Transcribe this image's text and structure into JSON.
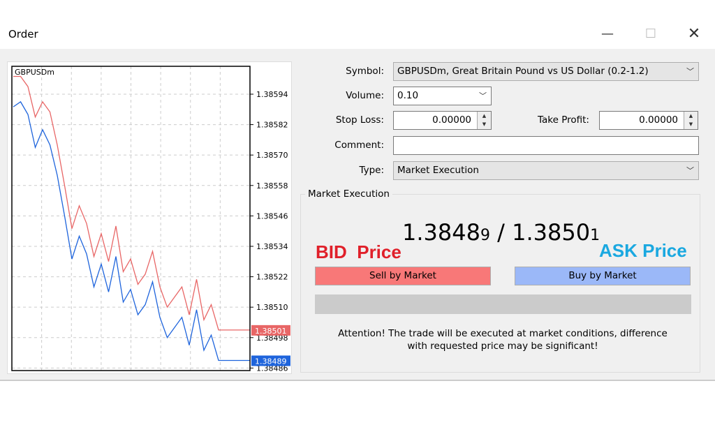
{
  "window": {
    "title": "Order",
    "minimize_icon": "minimize-icon",
    "maximize_icon": "maximize-icon",
    "close_icon": "close-icon"
  },
  "chart_data": {
    "type": "line",
    "title": "GBPUSDm",
    "ylim": [
      1.38485,
      1.38605
    ],
    "grid": true,
    "yticks": [
      "1.38594",
      "1.38582",
      "1.38570",
      "1.38558",
      "1.38546",
      "1.38534",
      "1.38522",
      "1.38510",
      "1.38498",
      "1.38486"
    ],
    "series": [
      {
        "color": "#e86666",
        "values": [
          1.38601,
          1.38601,
          1.38597,
          1.38585,
          1.38591,
          1.38587,
          1.38574,
          1.38558,
          1.38541,
          1.3855,
          1.38543,
          1.3853,
          1.38539,
          1.38528,
          1.38542,
          1.38524,
          1.38529,
          1.38519,
          1.38523,
          1.38532,
          1.38518,
          1.3851,
          1.38514,
          1.38518,
          1.38507,
          1.38521,
          1.38505,
          1.38511,
          1.38501,
          1.38501
        ]
      },
      {
        "color": "#1e64dc",
        "values": [
          1.38589,
          1.38591,
          1.38586,
          1.38573,
          1.3858,
          1.38574,
          1.38562,
          1.38546,
          1.38529,
          1.38538,
          1.38531,
          1.38518,
          1.38527,
          1.38516,
          1.3853,
          1.38512,
          1.38517,
          1.38507,
          1.38511,
          1.3852,
          1.38506,
          1.38498,
          1.38502,
          1.38506,
          1.38495,
          1.38509,
          1.38493,
          1.38499,
          1.38489,
          1.38489
        ]
      }
    ],
    "price_labels": [
      {
        "text": "1.38501",
        "color": "#e86666"
      },
      {
        "text": "1.38489",
        "color": "#1e64dc"
      }
    ]
  },
  "form": {
    "symbol_label": "Symbol:",
    "symbol_value": "GBPUSDm, Great Britain Pound vs US Dollar (0.2-1.2)",
    "volume_label": "Volume:",
    "volume_value": "0.10",
    "stoploss_label": "Stop Loss:",
    "stoploss_value": "0.00000",
    "takeprofit_label": "Take Profit:",
    "takeprofit_value": "0.00000",
    "comment_label": "Comment:",
    "comment_value": "",
    "type_label": "Type:",
    "type_value": "Market Execution"
  },
  "market": {
    "group_title": "Market Execution",
    "bid": "1.3848",
    "bid_small": "9",
    "sep": " / ",
    "ask": "1.3850",
    "ask_small": "1",
    "bid_annotation": "BID  Price",
    "ask_annotation": "ASK Price",
    "bid_color": "#e0202a",
    "ask_color": "#1aa8e0",
    "sell_label": "Sell by Market",
    "buy_label": "Buy by Market",
    "sell_color": "#f87878",
    "buy_color": "#9bb8f8",
    "attention": "Attention! The trade will be executed at market conditions, difference with requested price may be significant!"
  }
}
